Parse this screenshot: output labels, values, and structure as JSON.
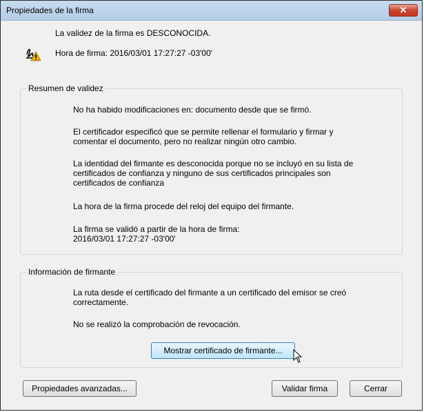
{
  "window": {
    "title": "Propiedades de la firma",
    "close_label": "✕"
  },
  "header": {
    "status": "La validez de la firma es DESCONOCIDA.",
    "time": "Hora de firma:  2016/03/01 17:27:27 -03'00'"
  },
  "validity": {
    "legend": "Resumen de validez",
    "p1": "No ha habido modificaciones en: documento desde que se firmó.",
    "p2a": "El certificador especificó que se permite rellenar el formulario y firmar y",
    "p2b": "comentar el documento, pero no realizar ningún otro cambio.",
    "p3a": "La identidad del firmante es desconocida porque no se incluyó en su lista de",
    "p3b": "certificados de confianza y ninguno de sus certificados principales son",
    "p3c": "certificados de confianza",
    "p4": "La hora de la firma procede del reloj del equipo del firmante.",
    "p5a": "La firma se validó a partir de la hora de firma:",
    "p5b": "2016/03/01 17:27:27 -03'00'"
  },
  "signer": {
    "legend": "Información de firmante",
    "p1a": "La ruta desde el certificado del firmante a un certificado del emisor se creó",
    "p1b": "correctamente.",
    "p2": "No se realizó la comprobación de revocación.",
    "show_cert_button": "Mostrar certificado de firmante..."
  },
  "footer": {
    "advanced_button": "Propiedades avanzadas...",
    "validate_button": "Validar firma",
    "close_button": "Cerrar"
  },
  "colors": {
    "warning": "#f5b400",
    "title_bar": "#c7dbef",
    "close_red": "#c8452e"
  }
}
